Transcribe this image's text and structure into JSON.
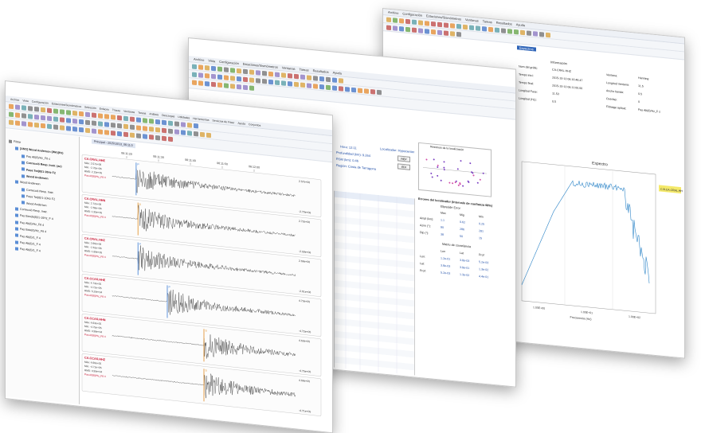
{
  "back_window": {
    "menu": [
      "Archivo",
      "Configuración",
      "Estaciones/Sismómetros",
      "Ventanas",
      "Tareas",
      "Resultados",
      "Ayuda"
    ],
    "tab": "Espectros",
    "info_header": "Información",
    "info_rows": [
      [
        "Nom del gràfic:",
        "CA.CRAL.HHZ",
        "Ventana:",
        "Hanning"
      ],
      [
        "Temps inici:",
        "2015-10-13 06:10:48.47",
        "Longitud Ventana:",
        "11.5"
      ],
      [
        "Temps final:",
        "2015-10-13 06:11:00.00",
        "Ancho banda:",
        "0.5"
      ],
      [
        "Longitud Fase:",
        "11.53",
        "Overlap:",
        "0"
      ],
      [
        "Longitud (Hz):",
        "0.5",
        "Filtratge aplicat:",
        "Pas Alt(8)/Hz_F ≤"
      ]
    ],
    "chart_title": "Espectro",
    "legend": "C.B.CA.CRAL.HHZ",
    "x_label": "Frecuencia (Hz)",
    "x_ticks": [
      "1.00E+00",
      "1.00E+01",
      "1.00E+02"
    ]
  },
  "mid_window": {
    "menu": [
      "Archivo",
      "Vista",
      "Configuración",
      "Estaciones/Sismómetros",
      "Ventanas",
      "Tareas",
      "Resultados",
      "Ayuda"
    ],
    "fields": {
      "time": "Hora: 12:11",
      "depth": "Profundidad (km): 9.264",
      "rms": "RSM (km): 0.46",
      "region": "Región: Costa de Tarragona",
      "localizador": "Localizador: Hypocenter",
      "lat": "Lat: 1.4E+00",
      "lon": "Lon: 1.3E+00"
    },
    "buttons": [
      "REP",
      "EDI"
    ],
    "mini_plot_title": "Residuos de la localización",
    "error_panel_title": "Errores del localizador (Intervalo de confianza 68%)",
    "error_subtitle": "Elipsoide Error",
    "error_header": [
      "Max",
      "Mig",
      "Min"
    ],
    "error_rows": [
      [
        "Ampl (km):",
        "1.1",
        "0.62",
        "0.25"
      ],
      [
        "Azim (°):",
        "90",
        "286",
        "281"
      ],
      [
        "Dip (°):",
        "38",
        "50",
        "15"
      ]
    ],
    "cov_title": "Matriu de covariància",
    "cov_header": [
      "Lon",
      "Lat",
      "Prof"
    ],
    "cov_rows": [
      [
        "Lon:",
        "1.2e-01",
        "3.8e-03",
        "5.2e-03"
      ],
      [
        "Lat:",
        "3.8e-03",
        "3.9e-01",
        "1.3e-02"
      ],
      [
        "Prof:",
        "5.2e-03",
        "1.3e-02",
        "4.4e-01"
      ]
    ]
  },
  "front_window": {
    "menu": [
      "Archivo",
      "Vista",
      "Configuración",
      "Estaciones/Sismómetros",
      "Selección",
      "Enlaces",
      "Trazas",
      "Ventanas",
      "Tareas",
      "Análisis",
      "Descargas",
      "Utilidades",
      "Herramientas",
      "Servicios de Fitxer",
      "Ayuda",
      "Conjuntos"
    ],
    "tab_main": "Principal",
    "tree": [
      {
        "label": "Filtrar",
        "level": 0,
        "color": "normal"
      },
      {
        "label": "[ANS] Wood Anderson (WA)(Hz)",
        "level": 1,
        "color": "bold"
      },
      {
        "label": "Pas Alt(8)/Hz_F8 ≤",
        "level": 2,
        "color": "normal"
      },
      {
        "label": "Correcció Resp. Instr. (ac)",
        "level": 2,
        "color": "bold"
      },
      {
        "label": "Pasa Tot(8)/1-10Hz F2",
        "level": 2,
        "color": "bold"
      },
      {
        "label": "Wood Anderson",
        "level": 2,
        "color": "bold"
      },
      {
        "label": "Wood Anderson",
        "level": 1,
        "color": "normal"
      },
      {
        "label": "Correcció Resp. Instr.",
        "level": 2,
        "color": "normal"
      },
      {
        "label": "Pasa Tot(8)/1-10Hz F2",
        "level": 2,
        "color": "normal"
      },
      {
        "label": "Wood Anderson",
        "level": 2,
        "color": "normal"
      },
      {
        "label": "Correcció Resp. Instr.",
        "level": 1,
        "color": "normal"
      },
      {
        "label": "Pas Banda(8)/1-10Hz_F 4",
        "level": 1,
        "color": "normal"
      },
      {
        "label": "Pas Alt(8)/Hz_F8 4",
        "level": 1,
        "color": "normal"
      },
      {
        "label": "Pas Baix(8)/Hz_F8 4",
        "level": 1,
        "color": "normal"
      },
      {
        "label": "Pas Alt(8)/1_F 4",
        "level": 1,
        "color": "normal"
      },
      {
        "label": "Pas Alt(8)/1_F 4",
        "level": 1,
        "color": "normal"
      },
      {
        "label": "Pas Alt(8)/1_F 4",
        "level": 1,
        "color": "normal"
      }
    ],
    "plot_tab": "Principal - 2015/10/13_06:11:0",
    "time_ticks": [
      "06:11:20",
      "06:11:30",
      "06:11:40",
      "06:11:50",
      "06:12:00"
    ],
    "traces": [
      {
        "station": "CA.CRAL.HHE",
        "max": "Màx: 2.57e+06",
        "min": "Mín: -2.70e+06",
        "rms": "RMS: 2.15e+05",
        "filter": "Pas Alt(8)/Hz_F8 4",
        "scale_top": "2.57e+06",
        "scale_bot": "-2.70e+06",
        "onset": 0.13,
        "pick": "P"
      },
      {
        "station": "CA.CRAL.HHN",
        "max": "Màx: 2.72e+06",
        "min": "Mín: -2.59e+06",
        "rms": "RMS: 1.95e+05",
        "filter": "Pas Alt(8)/Hz_F8 4",
        "scale_top": "2.72e+06",
        "scale_bot": "-2.59e+06",
        "onset": 0.14,
        "pick": "S"
      },
      {
        "station": "CA.CRAL.HHZ",
        "max": "Màx: 2.66e+06",
        "min": "Mín: -2.61e+06",
        "rms": "RMS: 1.89e+05",
        "filter": "Pas Alt(8)/Hz_F8 4",
        "scale_top": "2.66e+06",
        "scale_bot": "-2.61e+06",
        "onset": 0.14,
        "pick": "P"
      },
      {
        "station": "CA.CCAS.HHE",
        "max": "Màx: 4.73e+05",
        "min": "Mín: -4.72e+05",
        "rms": "RMS: 5.20e+04",
        "filter": "Pas Alt(8)/Hz_F8 4",
        "scale_top": "4.73e+05",
        "scale_bot": "-4.72e+05",
        "onset": 0.3,
        "pick": "P"
      },
      {
        "station": "CA.CCAS.HHN",
        "max": "Màx: 4.63e+05",
        "min": "Mín: -4.75e+05",
        "rms": "RMS: 4.98e+04",
        "filter": "Pas Alt(8)/Hz_F8 4",
        "scale_top": "4.63e+05",
        "scale_bot": "-4.75e+05",
        "onset": 0.5,
        "pick": "S"
      },
      {
        "station": "CA.CCAS.HHZ",
        "max": "Màx: 4.66e+05",
        "min": "Mín: -4.71e+05",
        "rms": "RMS: 4.90e+04",
        "filter": "Pas Alt(8)/Hz_F8 4",
        "scale_top": "4.66e+05",
        "scale_bot": "-4.71e+05",
        "onset": 0.5,
        "pick": "S"
      }
    ]
  },
  "colors": {
    "trace": "#2b2b2b",
    "pick_p": "#3a7bd5",
    "pick_s": "#e08a1e",
    "station_label": "#c8102e",
    "spectrum": "#2f86c8",
    "accent": "#2e64b8"
  }
}
